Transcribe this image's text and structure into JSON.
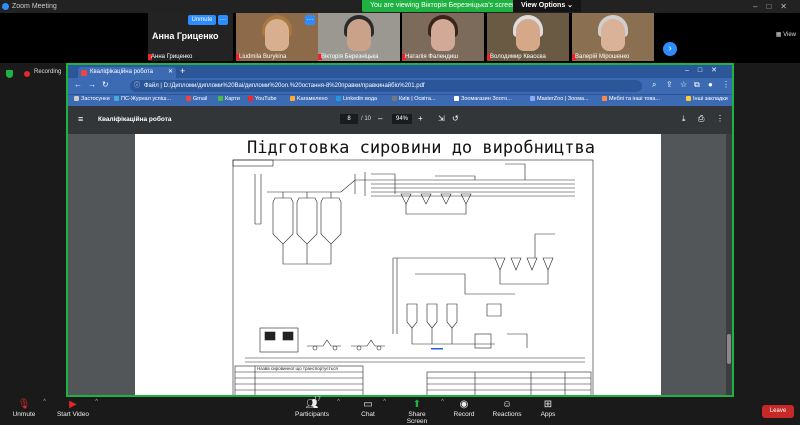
{
  "zoom": {
    "app_title": "Zoom Meeting",
    "banner": "You are viewing Вікторія Березніцька's screen",
    "view_options": "View Options",
    "view_label": "View",
    "recording_label": "Recording",
    "participants": [
      {
        "name": "Анна Гриценко",
        "big_name": "Анна Гриценко",
        "unmute": "Unmute"
      },
      {
        "name": "Liudmila Burykina"
      },
      {
        "name": "Вікторія Березніцька"
      },
      {
        "name": "Наталія Фалендиш"
      },
      {
        "name": "Володимир Квасєва"
      },
      {
        "name": "Валерій Мірошенко"
      }
    ],
    "toolbar": {
      "unmute": "Unmute",
      "start_video": "Start Video",
      "participants": "Participants",
      "participants_count": "17",
      "chat": "Chat",
      "share_screen": "Share Screen",
      "record": "Record",
      "reactions": "Reactions",
      "apps": "Apps",
      "leave": "Leave"
    }
  },
  "browser": {
    "tab_title": "Кваліфікаційна робота",
    "address_prefix": "Файл",
    "url": "D:/Дипломи/дипломи%20Bаі/дипломи%20on.%20остання-8%20правки/правкинайбіо%201.pdf",
    "bookmarks": [
      "Застосунки",
      "ПС-Журнал успіш...",
      "Gmail",
      "Карти",
      "YouTube",
      "Karaмелено",
      "Linkedin вода",
      "Київ | Освіта...",
      "Зоомагазин Зоото...",
      "MasterZoo | Зоома...",
      "Меблі та інші това...",
      "Інші закладки"
    ],
    "pdf_title": "Кваліфікаційна робота",
    "page_current": "8",
    "page_total": "/ 10",
    "zoom_level": "94%",
    "pdf_heading": "Підготовка сировини до виробництва",
    "stamp_caption": "Назва сировинної що транспортується"
  }
}
